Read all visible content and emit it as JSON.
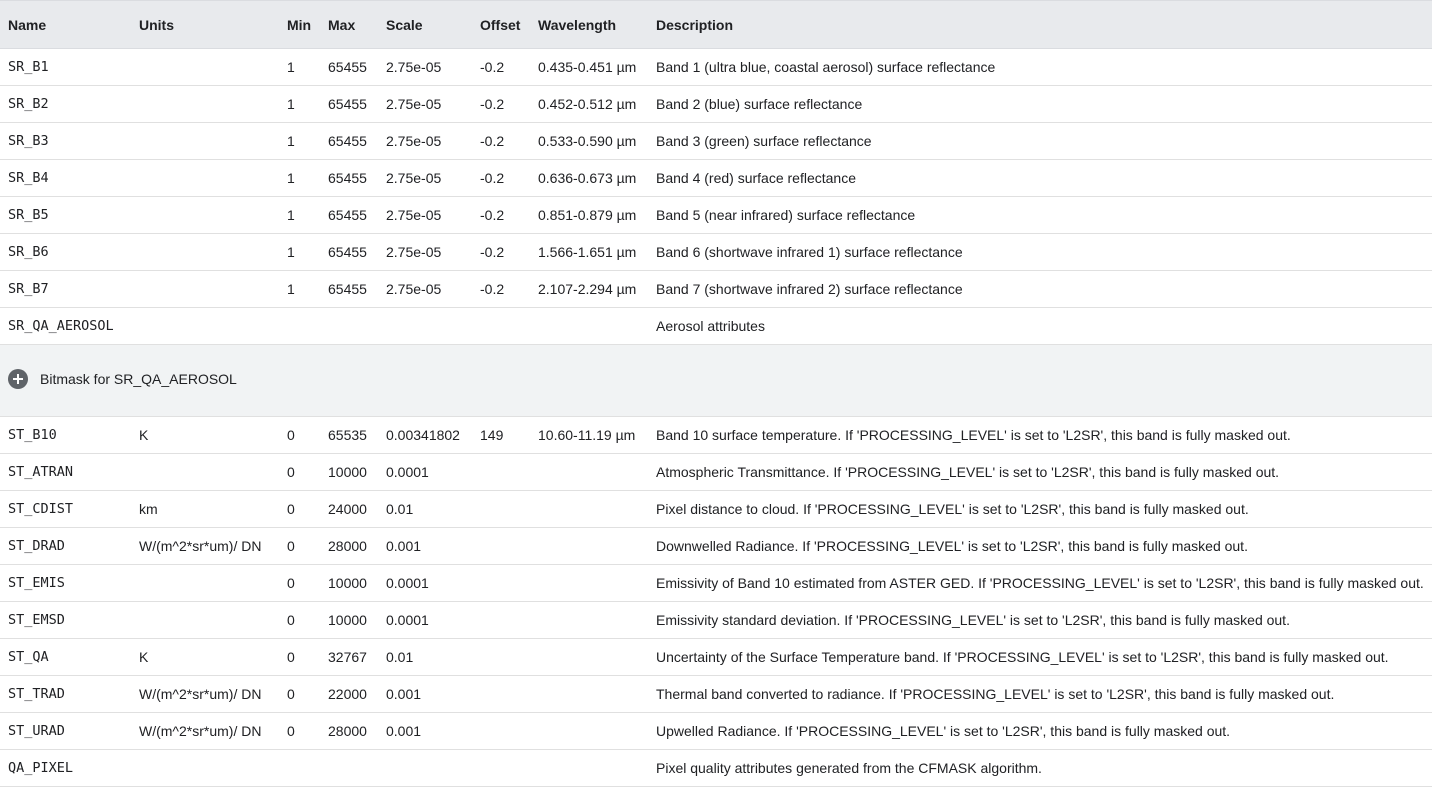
{
  "headers": {
    "name": "Name",
    "units": "Units",
    "min": "Min",
    "max": "Max",
    "scale": "Scale",
    "offset": "Offset",
    "wavelength": "Wavelength",
    "description": "Description"
  },
  "rows_top": [
    {
      "name": "SR_B1",
      "units": "",
      "min": "1",
      "max": "65455",
      "scale": "2.75e-05",
      "offset": "-0.2",
      "wavelength": "0.435-0.451 µm",
      "description": "Band 1 (ultra blue, coastal aerosol) surface reflectance"
    },
    {
      "name": "SR_B2",
      "units": "",
      "min": "1",
      "max": "65455",
      "scale": "2.75e-05",
      "offset": "-0.2",
      "wavelength": "0.452-0.512 µm",
      "description": "Band 2 (blue) surface reflectance"
    },
    {
      "name": "SR_B3",
      "units": "",
      "min": "1",
      "max": "65455",
      "scale": "2.75e-05",
      "offset": "-0.2",
      "wavelength": "0.533-0.590 µm",
      "description": "Band 3 (green) surface reflectance"
    },
    {
      "name": "SR_B4",
      "units": "",
      "min": "1",
      "max": "65455",
      "scale": "2.75e-05",
      "offset": "-0.2",
      "wavelength": "0.636-0.673 µm",
      "description": "Band 4 (red) surface reflectance"
    },
    {
      "name": "SR_B5",
      "units": "",
      "min": "1",
      "max": "65455",
      "scale": "2.75e-05",
      "offset": "-0.2",
      "wavelength": "0.851-0.879 µm",
      "description": "Band 5 (near infrared) surface reflectance"
    },
    {
      "name": "SR_B6",
      "units": "",
      "min": "1",
      "max": "65455",
      "scale": "2.75e-05",
      "offset": "-0.2",
      "wavelength": "1.566-1.651 µm",
      "description": "Band 6 (shortwave infrared 1) surface reflectance"
    },
    {
      "name": "SR_B7",
      "units": "",
      "min": "1",
      "max": "65455",
      "scale": "2.75e-05",
      "offset": "-0.2",
      "wavelength": "2.107-2.294 µm",
      "description": "Band 7 (shortwave infrared 2) surface reflectance"
    },
    {
      "name": "SR_QA_AEROSOL",
      "units": "",
      "min": "",
      "max": "",
      "scale": "",
      "offset": "",
      "wavelength": "",
      "description": "Aerosol attributes"
    }
  ],
  "bitmask": {
    "label": "Bitmask for SR_QA_AEROSOL",
    "icon": "plus-circle-icon"
  },
  "rows_bottom": [
    {
      "name": "ST_B10",
      "units": "K",
      "min": "0",
      "max": "65535",
      "scale": "0.00341802",
      "offset": "149",
      "wavelength": "10.60-11.19 µm",
      "description": "Band 10 surface temperature. If 'PROCESSING_LEVEL' is set to 'L2SR', this band is fully masked out."
    },
    {
      "name": "ST_ATRAN",
      "units": "",
      "min": "0",
      "max": "10000",
      "scale": "0.0001",
      "offset": "",
      "wavelength": "",
      "description": "Atmospheric Transmittance. If 'PROCESSING_LEVEL' is set to 'L2SR', this band is fully masked out."
    },
    {
      "name": "ST_CDIST",
      "units": "km",
      "min": "0",
      "max": "24000",
      "scale": "0.01",
      "offset": "",
      "wavelength": "",
      "description": "Pixel distance to cloud. If 'PROCESSING_LEVEL' is set to 'L2SR', this band is fully masked out."
    },
    {
      "name": "ST_DRAD",
      "units": "W/(m^2*sr*um)/ DN",
      "min": "0",
      "max": "28000",
      "scale": "0.001",
      "offset": "",
      "wavelength": "",
      "description": "Downwelled Radiance. If 'PROCESSING_LEVEL' is set to 'L2SR', this band is fully masked out."
    },
    {
      "name": "ST_EMIS",
      "units": "",
      "min": "0",
      "max": "10000",
      "scale": "0.0001",
      "offset": "",
      "wavelength": "",
      "description": "Emissivity of Band 10 estimated from ASTER GED. If 'PROCESSING_LEVEL' is set to 'L2SR', this band is fully masked out."
    },
    {
      "name": "ST_EMSD",
      "units": "",
      "min": "0",
      "max": "10000",
      "scale": "0.0001",
      "offset": "",
      "wavelength": "",
      "description": "Emissivity standard deviation. If 'PROCESSING_LEVEL' is set to 'L2SR', this band is fully masked out."
    },
    {
      "name": "ST_QA",
      "units": "K",
      "min": "0",
      "max": "32767",
      "scale": "0.01",
      "offset": "",
      "wavelength": "",
      "description": "Uncertainty of the Surface Temperature band. If 'PROCESSING_LEVEL' is set to 'L2SR', this band is fully masked out."
    },
    {
      "name": "ST_TRAD",
      "units": "W/(m^2*sr*um)/ DN",
      "min": "0",
      "max": "22000",
      "scale": "0.001",
      "offset": "",
      "wavelength": "",
      "description": "Thermal band converted to radiance. If 'PROCESSING_LEVEL' is set to 'L2SR', this band is fully masked out."
    },
    {
      "name": "ST_URAD",
      "units": "W/(m^2*sr*um)/ DN",
      "min": "0",
      "max": "28000",
      "scale": "0.001",
      "offset": "",
      "wavelength": "",
      "description": "Upwelled Radiance. If 'PROCESSING_LEVEL' is set to 'L2SR', this band is fully masked out."
    },
    {
      "name": "QA_PIXEL",
      "units": "",
      "min": "",
      "max": "",
      "scale": "",
      "offset": "",
      "wavelength": "",
      "description": "Pixel quality attributes generated from the CFMASK algorithm."
    }
  ]
}
